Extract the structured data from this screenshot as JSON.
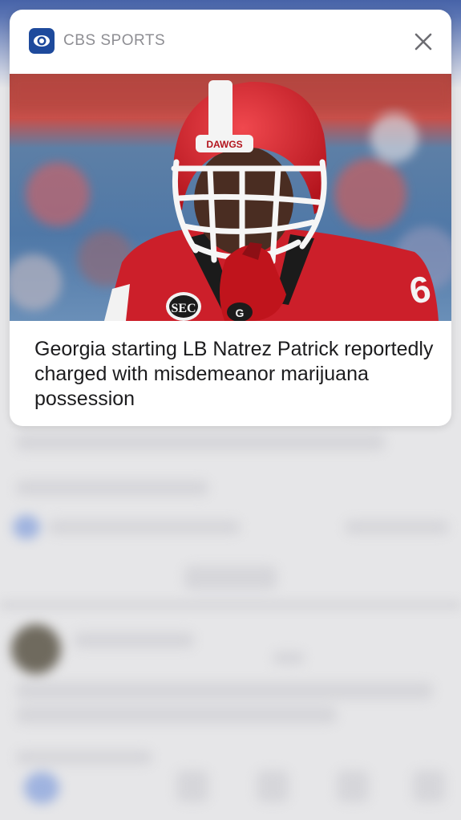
{
  "notification": {
    "app_name": "CBS SPORTS",
    "app_icon": "cbs-eye-icon",
    "close_icon": "close-icon",
    "image_subject": "football-player-in-red-helmet",
    "helmet_text": "DAWGS",
    "jersey_logo_text": "SEC",
    "jersey_number": "6",
    "headline": "Georgia starting LB Natrez Patrick reportedly charged with misdemeanor marijuana possession"
  },
  "colors": {
    "brand_blue": "#1e4a9c",
    "helmet_red": "#d8202b",
    "card_bg": "#ffffff",
    "headline_text": "#1c1c1e",
    "app_name_text": "#8e8e93"
  }
}
